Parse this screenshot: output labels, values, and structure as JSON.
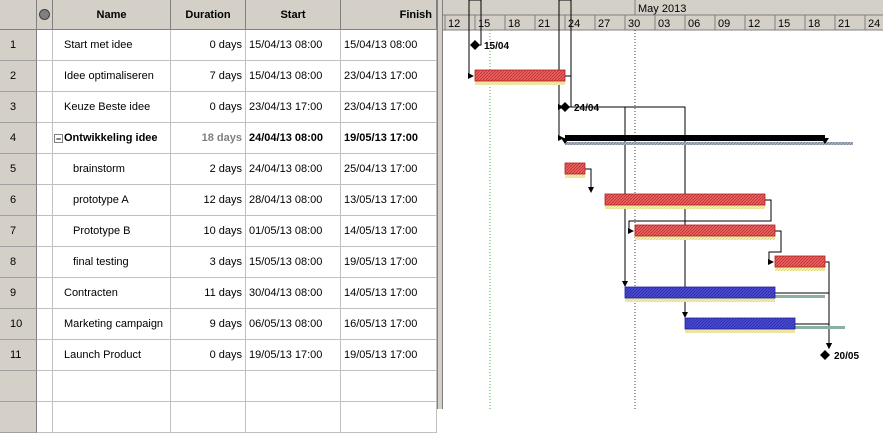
{
  "columns": {
    "indicators_icon": "indicators-icon",
    "name": "Name",
    "duration": "Duration",
    "start": "Start",
    "finish": "Finish"
  },
  "timescale": {
    "month": "May 2013",
    "days": [
      "12",
      "15",
      "18",
      "21",
      "24",
      "27",
      "30",
      "03",
      "06",
      "09",
      "12",
      "15",
      "18",
      "21",
      "24"
    ]
  },
  "tasks": [
    {
      "id": "1",
      "name": "Start met idee",
      "duration": "0 days",
      "start": "15/04/13 08:00",
      "finish": "15/04/13 08:00",
      "type": "milestone",
      "label": "15/04"
    },
    {
      "id": "2",
      "name": "Idee optimaliseren",
      "duration": "7 days",
      "start": "15/04/13 08:00",
      "finish": "23/04/13 17:00",
      "type": "task"
    },
    {
      "id": "3",
      "name": "Keuze Beste idee",
      "duration": "0 days",
      "start": "23/04/13 17:00",
      "finish": "23/04/13 17:00",
      "type": "milestone",
      "label": "24/04"
    },
    {
      "id": "4",
      "name": "Ontwikkeling idee",
      "duration": "18 days",
      "start": "24/04/13 08:00",
      "finish": "19/05/13 17:00",
      "type": "summary",
      "collapse_symbol": "−"
    },
    {
      "id": "5",
      "name": "brainstorm",
      "duration": "2 days",
      "start": "24/04/13 08:00",
      "finish": "25/04/13 17:00",
      "type": "task"
    },
    {
      "id": "6",
      "name": "prototype A",
      "duration": "12 days",
      "start": "28/04/13 08:00",
      "finish": "13/05/13 17:00",
      "type": "task"
    },
    {
      "id": "7",
      "name": "Prototype B",
      "duration": "10 days",
      "start": "01/05/13 08:00",
      "finish": "14/05/13 17:00",
      "type": "task"
    },
    {
      "id": "8",
      "name": "final testing",
      "duration": "3 days",
      "start": "15/05/13 08:00",
      "finish": "19/05/13 17:00",
      "type": "task"
    },
    {
      "id": "9",
      "name": "Contracten",
      "duration": "11 days",
      "start": "30/04/13 08:00",
      "finish": "14/05/13 17:00",
      "type": "resource"
    },
    {
      "id": "10",
      "name": "Marketing campaign",
      "duration": "9 days",
      "start": "06/05/13 08:00",
      "finish": "16/05/13 17:00",
      "type": "resource"
    },
    {
      "id": "11",
      "name": "Launch Product",
      "duration": "0 days",
      "start": "19/05/13 17:00",
      "finish": "19/05/13 17:00",
      "type": "milestone",
      "label": "20/05"
    }
  ],
  "colors": {
    "task_bar": "#e05050",
    "resource_bar": "#4040c8",
    "summary_bar": "#000000",
    "baseline": "#f0e8a0",
    "grid": "#c0c0c0"
  }
}
